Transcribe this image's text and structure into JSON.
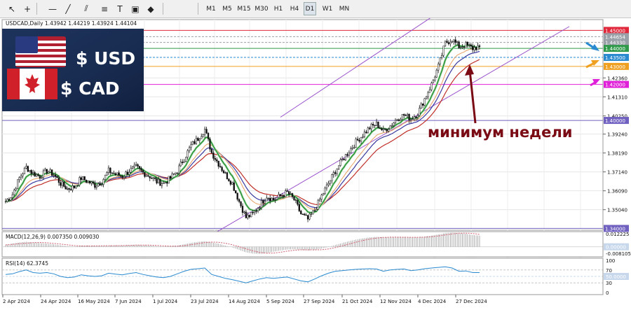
{
  "toolbar": {
    "tools": [
      "cursor-icon",
      "crosshair-icon",
      "hline-icon",
      "trendline-icon",
      "channel-icon",
      "fibo-icon",
      "text-icon",
      "label-icon",
      "shapes-icon"
    ],
    "timeframes": [
      "M1",
      "M5",
      "M15",
      "M30",
      "H1",
      "H4",
      "D1",
      "W1",
      "MN"
    ],
    "selected_timeframe": "D1"
  },
  "header": {
    "symbol_line": "USDCAD,Daily  1.43942 1.44219 1.43924 1.44104"
  },
  "logo": {
    "usd_text": "$ USD",
    "cad_text": "$ CAD"
  },
  "annotation": {
    "text": "минимум недели",
    "color": "#7a0a14"
  },
  "colors": {
    "candle": "#111111",
    "ema_fast": "#1e8a2e",
    "ema_fast_shadow": "#a8dca8",
    "ma_orange": "#e8a060",
    "ma_blue": "#3a3aa0",
    "ma_red": "#c0302a",
    "channel": "#9a52cc",
    "level_red": "#e0283a",
    "level_green": "#2e9a4a",
    "level_blue": "#2a8ad0",
    "level_orange": "#f0a020",
    "level_magenta": "#e020d8",
    "level_purple": "#7060c0",
    "macd": "#d06070",
    "rsi": "#2a8ad0"
  },
  "chart_data": [
    {
      "type": "line",
      "title": "USDCAD,Daily  1.43942 1.44219 1.43924 1.44104",
      "series": [
        {
          "values": [
            1.355,
            1.359,
            1.368,
            1.374,
            1.3705,
            1.369,
            1.372,
            1.37,
            1.365,
            1.362,
            1.363,
            1.368,
            1.366,
            1.364,
            1.366,
            1.372,
            1.37,
            1.369,
            1.372,
            1.374,
            1.371,
            1.369,
            1.366,
            1.365,
            1.368,
            1.372,
            1.379,
            1.386,
            1.39,
            1.395,
            1.382,
            1.376,
            1.37,
            1.365,
            1.355,
            1.346,
            1.348,
            1.353,
            1.358,
            1.356,
            1.358,
            1.36,
            1.356,
            1.348,
            1.345,
            1.35,
            1.358,
            1.365,
            1.372,
            1.378,
            1.383,
            1.388,
            1.392,
            1.396,
            1.398,
            1.394,
            1.397,
            1.401,
            1.403,
            1.401,
            1.404,
            1.412,
            1.42,
            1.43,
            1.443,
            1.445,
            1.441,
            1.442,
            1.44,
            1.441
          ]
        }
      ],
      "ylim": [
        1.339,
        1.456
      ],
      "y_ticks": [
        "1.35040",
        "1.36090",
        "1.37140",
        "1.38190",
        "1.39240",
        "1.40250",
        "1.41310",
        "1.42360"
      ],
      "x_ticks": [
        "2 Apr 2024",
        "24 Apr 2024",
        "16 May 2024",
        "7 Jun 2024",
        "1 Jul 2024",
        "23 Jul 2024",
        "14 Aug 2024",
        "5 Sep 2024",
        "27 Sep 2024",
        "21 Oct 2024",
        "12 Nov 2024",
        "4 Dec 2024",
        "27 Dec 2024"
      ],
      "levels": [
        {
          "label": "1.45000",
          "value": 1.45,
          "color": "#e0283a"
        },
        {
          "label": "1.44654",
          "value": 1.44654,
          "color": "#9aa0a8"
        },
        {
          "label": "1.44330",
          "value": 1.4433,
          "color": "#9aa0a8"
        },
        {
          "label": "1.44000",
          "value": 1.44,
          "color": "#2e9a4a"
        },
        {
          "label": "1.43500",
          "value": 1.435,
          "color": "#2a8ad0"
        },
        {
          "label": "1.43000",
          "value": 1.43,
          "color": "#f0a020"
        },
        {
          "label": "1.42000",
          "value": 1.42,
          "color": "#e020d8"
        },
        {
          "label": "1.40000",
          "value": 1.4,
          "color": "#7060c0"
        },
        {
          "label": "1.34000",
          "value": 1.34,
          "color": "#7060c0"
        }
      ],
      "grid": true
    },
    {
      "type": "bar",
      "title": "MACD(12,26,9) 0.007350 0.009030",
      "y_ticks": [
        "0.012225",
        "0.00000",
        "-0.008105"
      ],
      "values": [
        0.0015,
        0.0025,
        0.0035,
        0.004,
        0.0035,
        0.003,
        0.0025,
        0.002,
        0.0012,
        0.0005,
        0.0002,
        0.0008,
        0.001,
        0.0008,
        0.0006,
        0.001,
        0.0012,
        0.0011,
        0.0014,
        0.0016,
        0.0014,
        0.001,
        0.0005,
        0.0002,
        0.0004,
        0.001,
        0.002,
        0.0032,
        0.004,
        0.0045,
        0.0035,
        0.0025,
        0.001,
        -0.0005,
        -0.0025,
        -0.0045,
        -0.0055,
        -0.0058,
        -0.005,
        -0.004,
        -0.003,
        -0.0022,
        -0.002,
        -0.0026,
        -0.003,
        -0.0025,
        -0.0015,
        -0.0002,
        0.0015,
        0.003,
        0.0045,
        0.0058,
        0.0068,
        0.0076,
        0.008,
        0.0078,
        0.0076,
        0.0077,
        0.0078,
        0.0075,
        0.0076,
        0.0082,
        0.009,
        0.01,
        0.011,
        0.0115,
        0.0112,
        0.0105,
        0.0095,
        0.009
      ]
    },
    {
      "type": "line",
      "title": "RSI(14) 62.3745",
      "y_ticks": [
        "100",
        "70",
        "50.0000",
        "30",
        "0"
      ],
      "ylim": [
        0,
        100
      ],
      "values": [
        56,
        58,
        65,
        70,
        62,
        60,
        62,
        58,
        50,
        46,
        48,
        55,
        52,
        50,
        52,
        60,
        57,
        55,
        59,
        62,
        56,
        52,
        48,
        46,
        50,
        58,
        66,
        72,
        74,
        76,
        56,
        50,
        44,
        40,
        35,
        30,
        36,
        42,
        46,
        44,
        46,
        48,
        42,
        36,
        33,
        42,
        52,
        60,
        66,
        68,
        70,
        72,
        73,
        74,
        73,
        66,
        70,
        72,
        73,
        68,
        70,
        74,
        76,
        78,
        80,
        76,
        66,
        67,
        62,
        62
      ]
    }
  ]
}
